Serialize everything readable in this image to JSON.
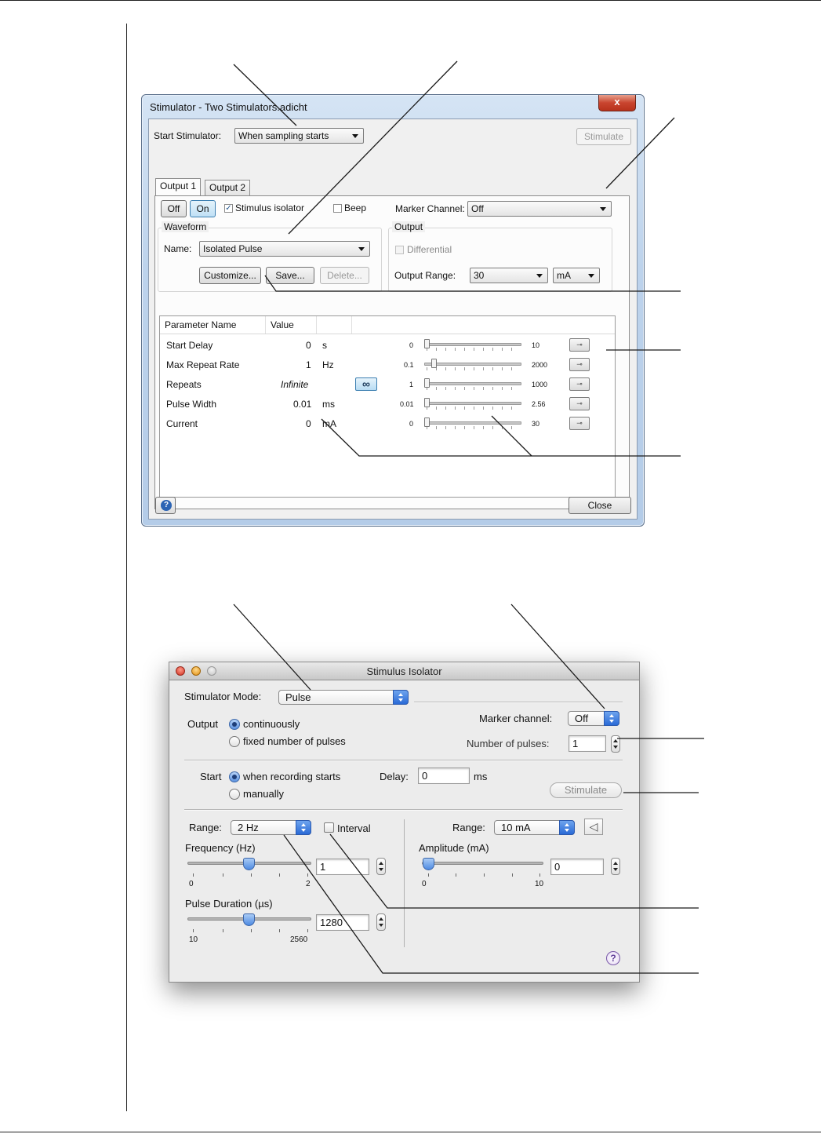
{
  "windows_dialog": {
    "title": "Stimulator - Two Stimulators.adicht",
    "close_glyph": "x",
    "start_stimulator_label": "Start Stimulator:",
    "start_stimulator_value": "When sampling starts",
    "stimulate_label": "Stimulate",
    "tabs": [
      {
        "label": "Output 1"
      },
      {
        "label": "Output 2"
      }
    ],
    "off_label": "Off",
    "on_label": "On",
    "stimulus_isolator_label": "Stimulus isolator",
    "beep_label": "Beep",
    "marker_channel_label": "Marker Channel:",
    "marker_channel_value": "Off",
    "waveform_group": "Waveform",
    "name_label": "Name:",
    "name_value": "Isolated Pulse",
    "customize_label": "Customize...",
    "save_label": "Save...",
    "delete_label": "Delete...",
    "output_group": "Output",
    "differential_label": "Differential",
    "output_range_label": "Output Range:",
    "output_range_value": "30",
    "output_unit_value": "mA",
    "columns": [
      "Parameter Name",
      "Value"
    ],
    "parameters": [
      {
        "name": "Start Delay",
        "value": "0",
        "unit": "s",
        "min": "0",
        "max": "10"
      },
      {
        "name": "Max Repeat Rate",
        "value": "1",
        "unit": "Hz",
        "min": "0.1",
        "max": "2000"
      },
      {
        "name": "Repeats",
        "value": "Infinite",
        "unit": "",
        "min": "1",
        "max": "1000"
      },
      {
        "name": "Pulse Width",
        "value": "0.01",
        "unit": "ms",
        "min": "0.01",
        "max": "2.56"
      },
      {
        "name": "Current",
        "value": "0",
        "unit": "mA",
        "min": "0",
        "max": "30"
      }
    ],
    "infinity_glyph": "∞",
    "help_glyph": "?",
    "close_label": "Close"
  },
  "mac_dialog": {
    "title": "Stimulus Isolator",
    "stimulator_mode_label": "Stimulator Mode:",
    "stimulator_mode_value": "Pulse",
    "output_label": "Output",
    "continuously_label": "continuously",
    "fixed_pulses_label": "fixed number of pulses",
    "marker_channel_label": "Marker channel:",
    "marker_channel_value": "Off",
    "number_of_pulses_label": "Number of pulses:",
    "number_of_pulses_value": "1",
    "start_label": "Start",
    "when_recording_label": "when recording starts",
    "manually_label": "manually",
    "delay_label": "Delay:",
    "delay_value": "0",
    "delay_unit": "ms",
    "stimulate_label": "Stimulate",
    "range_label": "Range:",
    "range_value": "2 Hz",
    "interval_label": "Interval",
    "frequency_label": "Frequency (Hz)",
    "frequency_value": "1",
    "frequency_min": "0",
    "frequency_max": "2",
    "pulse_duration_label": "Pulse Duration (µs)",
    "pulse_duration_value": "1280",
    "pulse_min": "10",
    "pulse_max": "2560",
    "amp_range_label": "Range:",
    "amp_range_value": "10 mA",
    "speaker_glyph": "◁",
    "amplitude_label": "Amplitude (mA)",
    "amplitude_value": "0",
    "amplitude_min": "0",
    "amplitude_max": "10",
    "help_glyph": "?"
  }
}
